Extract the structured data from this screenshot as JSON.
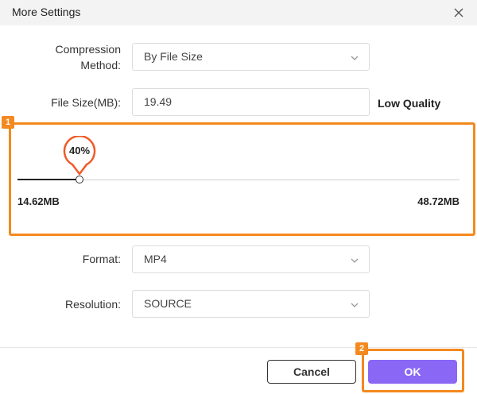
{
  "dialog": {
    "title": "More Settings",
    "close_icon": "close-icon"
  },
  "compression": {
    "label_line1": "Compression",
    "label_line2": "Method:",
    "value": "By File Size"
  },
  "file_size": {
    "label": "File Size(MB):",
    "value": "19.49",
    "quality": "Low Quality"
  },
  "slider": {
    "percent_label": "40%",
    "fraction": 0.14,
    "min_label": "14.62MB",
    "max_label": "48.72MB"
  },
  "format": {
    "label": "Format:",
    "value": "MP4"
  },
  "resolution": {
    "label": "Resolution:",
    "value": "SOURCE"
  },
  "buttons": {
    "cancel": "Cancel",
    "ok": "OK"
  },
  "markers": {
    "one": "1",
    "two": "2"
  },
  "colors": {
    "accent": "#8a67f5",
    "highlight": "#f4891f",
    "bubble": "#f05a28"
  }
}
